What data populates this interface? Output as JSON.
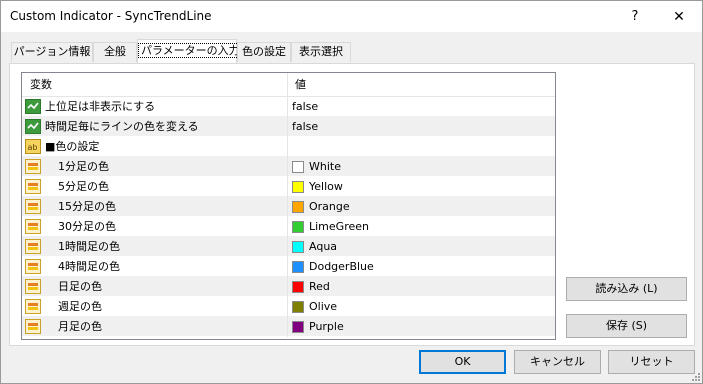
{
  "window": {
    "title": "Custom Indicator - SyncTrendLine",
    "help": "?",
    "close": "✕"
  },
  "tabs": [
    {
      "label": "パージョン情報"
    },
    {
      "label": "全般"
    },
    {
      "label": "パラメーターの入力"
    },
    {
      "label": "色の設定"
    },
    {
      "label": "表示選択"
    }
  ],
  "grid": {
    "col_variable": "変数",
    "col_value": "値",
    "rows": [
      {
        "label": "上位足は非表示にする",
        "value": "false",
        "icon": "bool-icon"
      },
      {
        "label": "時間足毎にラインの色を変える",
        "value": "false",
        "icon": "bool-icon"
      },
      {
        "label": "■色の設定",
        "value": "",
        "icon": "string-icon"
      },
      {
        "label": "1分足の色",
        "value": "White",
        "color": "#ffffff",
        "icon": "color-icon"
      },
      {
        "label": "5分足の色",
        "value": "Yellow",
        "color": "#ffff00",
        "icon": "color-icon"
      },
      {
        "label": "15分足の色",
        "value": "Orange",
        "color": "#ffa500",
        "icon": "color-icon"
      },
      {
        "label": "30分足の色",
        "value": "LimeGreen",
        "color": "#32cd32",
        "icon": "color-icon"
      },
      {
        "label": "1時間足の色",
        "value": "Aqua",
        "color": "#00ffff",
        "icon": "color-icon"
      },
      {
        "label": "4時間足の色",
        "value": "DodgerBlue",
        "color": "#1e90ff",
        "icon": "color-icon"
      },
      {
        "label": "日足の色",
        "value": "Red",
        "color": "#ff0000",
        "icon": "color-icon"
      },
      {
        "label": "週足の色",
        "value": "Olive",
        "color": "#808000",
        "icon": "color-icon"
      },
      {
        "label": "月足の色",
        "value": "Purple",
        "color": "#800080",
        "icon": "color-icon"
      }
    ]
  },
  "buttons": {
    "load": "読み込み (L)",
    "save": "保存 (S)",
    "ok": "OK",
    "cancel": "キャンセル",
    "reset": "リセット"
  }
}
